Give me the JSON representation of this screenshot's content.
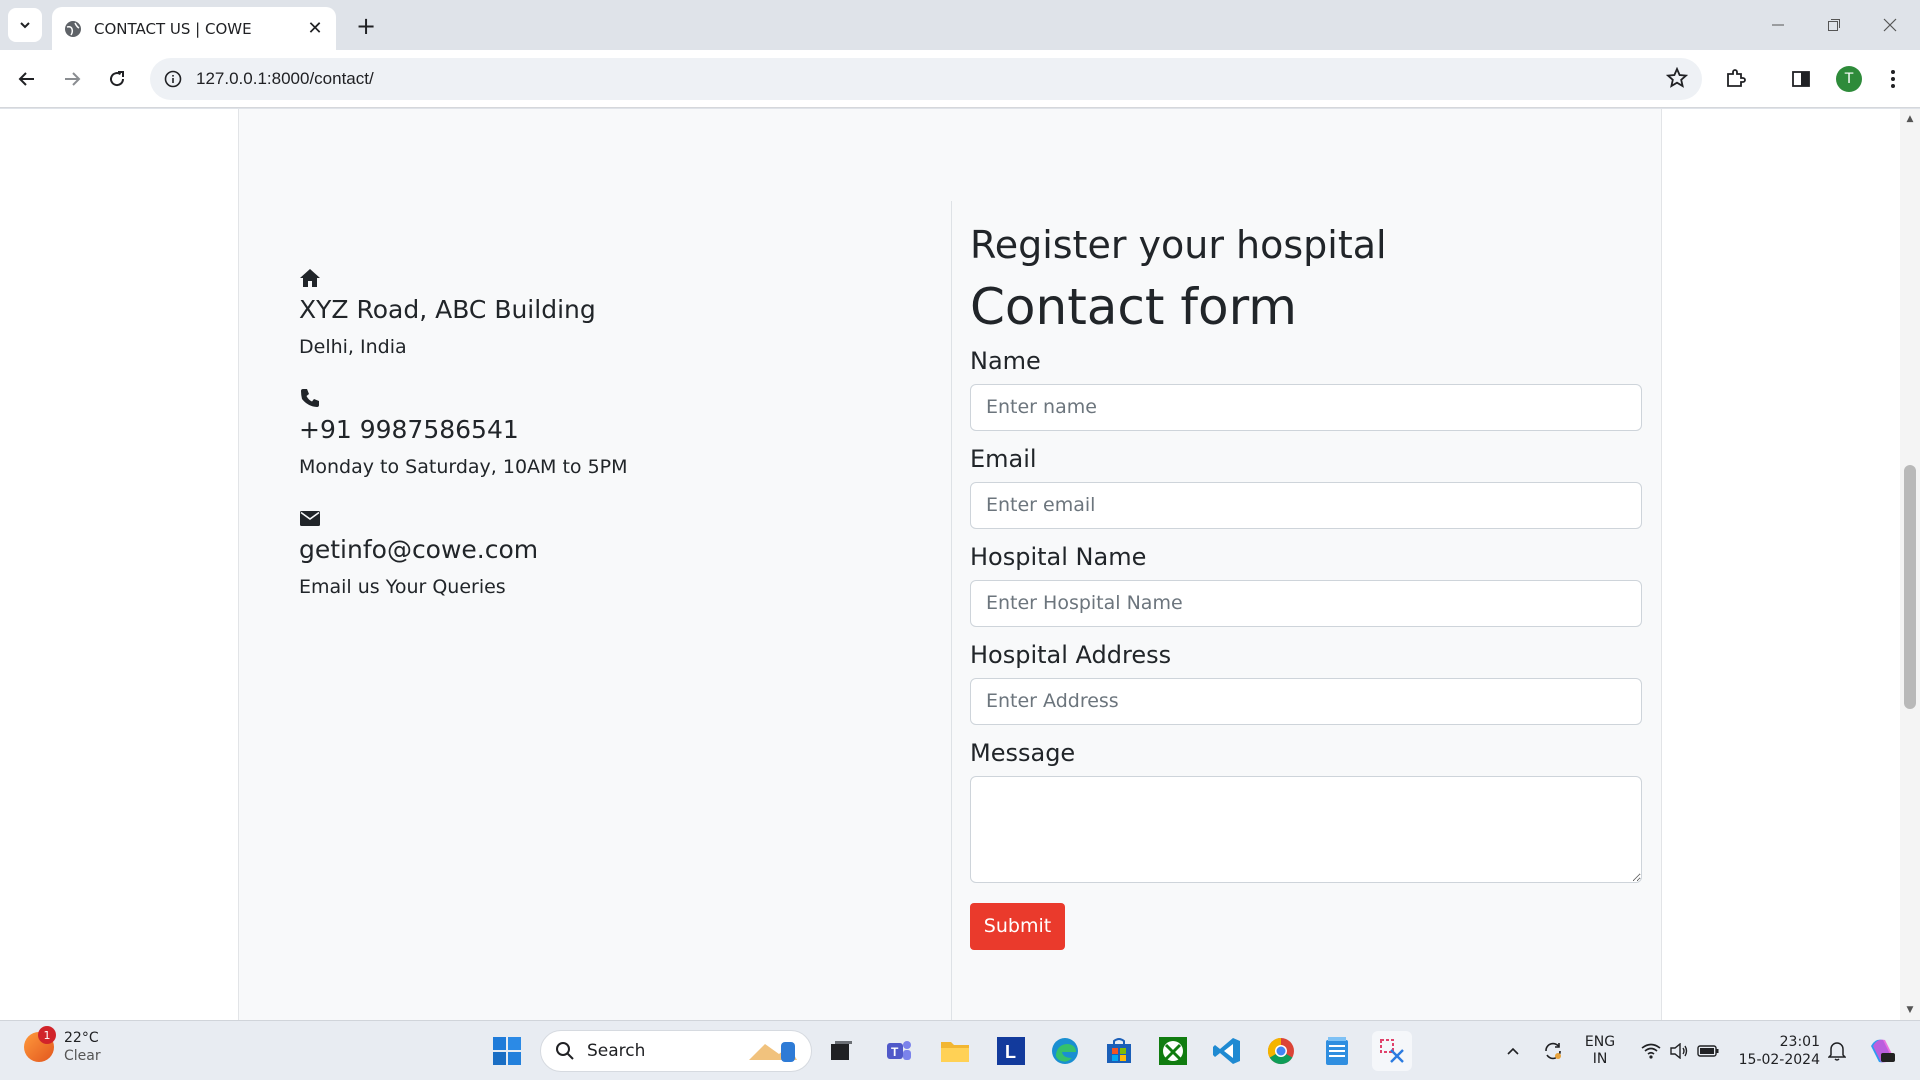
{
  "browser": {
    "tab_title": "CONTACT US | COWE",
    "url": "127.0.0.1:8000/contact/",
    "profile_initial": "T"
  },
  "contact_info": [
    {
      "icon": "home-icon",
      "heading": "XYZ Road, ABC Building",
      "subtext": "Delhi, India"
    },
    {
      "icon": "phone-icon",
      "heading": "+91 9987586541",
      "subtext": "Monday to Saturday, 10AM to 5PM"
    },
    {
      "icon": "envelope-icon",
      "heading": "getinfo@cowe.com",
      "subtext": "Email us Your Queries"
    }
  ],
  "form": {
    "subtitle": "Register your hospital",
    "title": "Contact form",
    "fields": [
      {
        "label": "Name",
        "placeholder": "Enter name"
      },
      {
        "label": "Email",
        "placeholder": "Enter email"
      },
      {
        "label": "Hospital Name",
        "placeholder": "Enter Hospital Name"
      },
      {
        "label": "Hospital Address",
        "placeholder": "Enter Address"
      }
    ],
    "message_label": "Message",
    "submit_label": "Submit",
    "submit_color": "#ea3a2c"
  },
  "taskbar": {
    "weather_temp": "22°C",
    "weather_desc": "Clear",
    "weather_badge": "1",
    "search_label": "Search",
    "lang_top": "ENG",
    "lang_bottom": "IN",
    "time": "23:01",
    "date": "15-02-2024"
  }
}
